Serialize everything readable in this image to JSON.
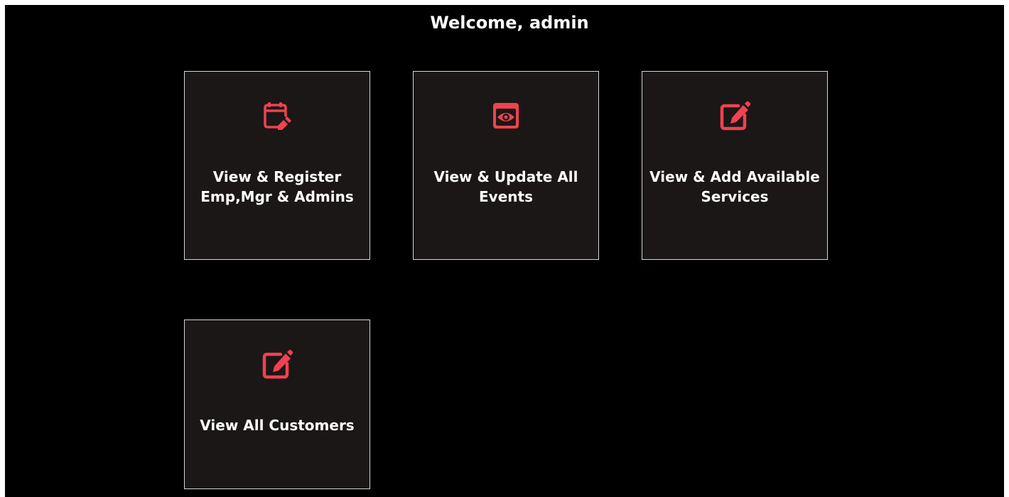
{
  "header": {
    "title": "Welcome, admin"
  },
  "theme": {
    "accent": "#f0424f",
    "card_background": "#1b1717",
    "page_background": "#000000"
  },
  "cards": [
    {
      "label": "View & Register Emp,Mgr & Admins",
      "icon": "calendar-edit-icon"
    },
    {
      "label": "View & Update All Events",
      "icon": "window-eye-icon"
    },
    {
      "label": "View & Add Available Services",
      "icon": "edit-square-icon"
    },
    {
      "label": "View All Customers",
      "icon": "edit-square-icon"
    }
  ]
}
